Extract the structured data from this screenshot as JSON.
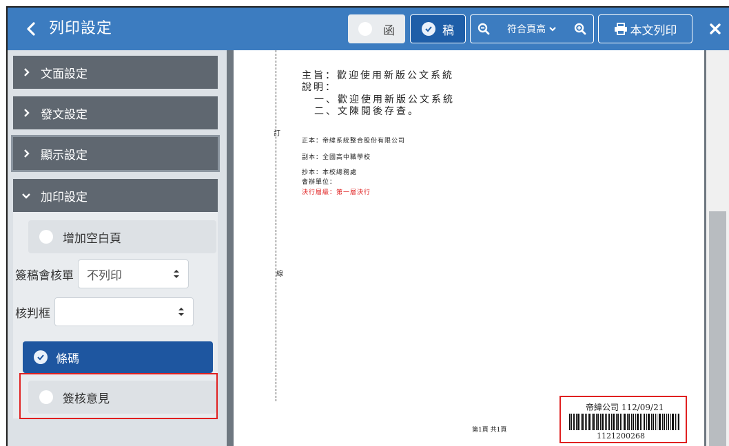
{
  "header": {
    "title": "列印設定",
    "letter_label": "函",
    "draft_label": "稿",
    "zoom_label": "符合頁高",
    "print_label": "本文列印"
  },
  "sidebar": {
    "panels": [
      {
        "label": "文面設定",
        "expanded": false
      },
      {
        "label": "發文設定",
        "expanded": false
      },
      {
        "label": "顯示設定",
        "expanded": false
      },
      {
        "label": "加印設定",
        "expanded": true
      }
    ],
    "options": {
      "blank_page": {
        "label": "增加空白頁",
        "checked": false
      },
      "sign_review_sheet": {
        "label": "簽稿會核單",
        "value": "不列印"
      },
      "judgment_box": {
        "label": "核判框",
        "value": ""
      },
      "barcode": {
        "label": "條碼",
        "checked": true
      },
      "review_opinion": {
        "label": "簽核意見",
        "checked": false
      }
    }
  },
  "document": {
    "subject": "主旨：歡迎使用新版公文系統",
    "explanation": "說明：",
    "item1": "一、歡迎使用新版公文系統",
    "item2": "二、文陳閱後存查。",
    "original": "正本：帝緯系統整合股份有限公司",
    "copy": "副本：全國高中職學校",
    "cc": "抄本：本校總務處",
    "co_units": "會辦單位：",
    "decision_level": "決行層級：第一層決行",
    "margin_top": "訂",
    "margin_bottom": "線",
    "page_footer": "第1頁 共1頁",
    "barcode_company": "帝緯公司 112/09/21",
    "barcode_number": "1121200268"
  },
  "colors": {
    "header_bg": "#3c7cc0",
    "panel_bg": "#5f6770",
    "selected_bg": "#1e56a0",
    "highlight_red": "#e02020"
  }
}
